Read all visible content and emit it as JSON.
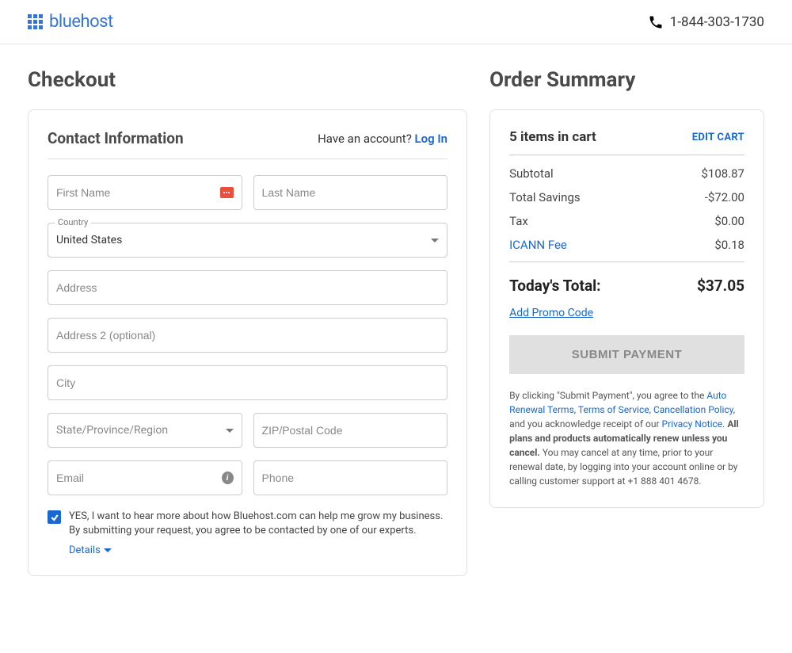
{
  "header": {
    "brand": "bluehost",
    "phone": "1-844-303-1730"
  },
  "checkout": {
    "title": "Checkout",
    "contact": {
      "heading": "Contact Information",
      "have_account": "Have an account? ",
      "login": "Log In",
      "first_name_ph": "First Name",
      "last_name_ph": "Last Name",
      "country_label": "Country",
      "country_value": "United States",
      "address_ph": "Address",
      "address2_ph": "Address 2 (optional)",
      "city_ph": "City",
      "state_ph": "State/Province/Region",
      "zip_ph": "ZIP/Postal Code",
      "email_ph": "Email",
      "phone_ph": "Phone",
      "optin_text": "YES, I want to hear more about how Bluehost.com can help me grow my business. By submitting your request, you agree to be contacted by one of our experts.",
      "details": "Details"
    }
  },
  "summary": {
    "title": "Order Summary",
    "items_in_cart": "5 items in cart",
    "edit_cart": "EDIT CART",
    "subtotal_label": "Subtotal",
    "subtotal_value": "$108.87",
    "savings_label": "Total Savings",
    "savings_value": "-$72.00",
    "tax_label": "Tax",
    "tax_value": "$0.00",
    "icann_label": "ICANN Fee",
    "icann_value": "$0.18",
    "total_label": "Today's Total:",
    "total_value": "$37.05",
    "promo": "Add Promo Code",
    "submit": "SUBMIT PAYMENT",
    "legal_prefix": "By clicking \"Submit Payment\", you agree to the ",
    "auto_renewal": "Auto Renewal Terms",
    "tos": "Terms of Service",
    "cancel_policy": "Cancellation Policy",
    "legal_mid": ", and you acknowledge receipt of our ",
    "privacy": "Privacy Notice",
    "legal_bold": "All plans and products automatically renew unless you cancel.",
    "legal_tail": " You may cancel at any time, prior to your renewal date, by logging into your account online or by calling customer support at +1 888 401 4678."
  }
}
